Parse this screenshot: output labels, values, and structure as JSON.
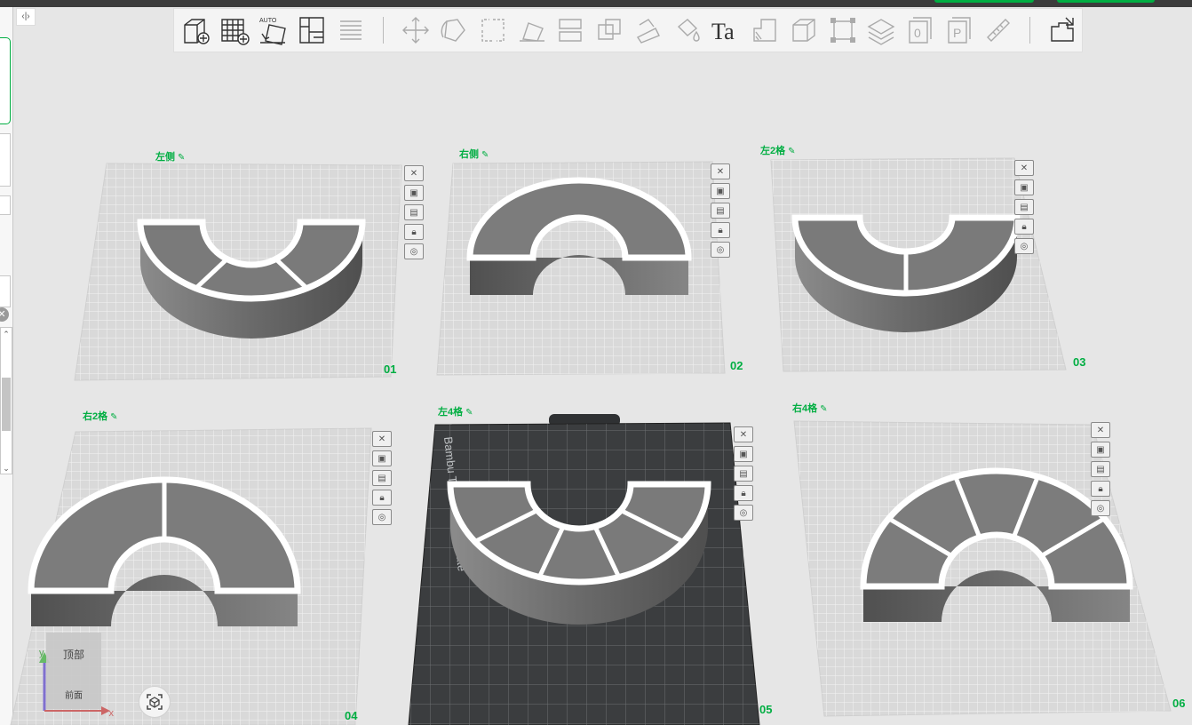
{
  "toolbar": {
    "collapse_glyph": "‹|›",
    "groups": [
      [
        "add-plate-icon",
        "grid-plate-icon",
        "auto-orient-icon",
        "arrange-icon",
        "layers-icon"
      ],
      [
        "move-icon",
        "rotate-icon",
        "scale-icon",
        "lay-on-face-icon",
        "split-icon",
        "boolean-icon",
        "support-paint-icon",
        "color-paint-icon",
        "text-icon",
        "height-range-icon",
        "cube-icon",
        "fit-bounds-icon",
        "layer-view-icon",
        "plate-0-icon",
        "plate-p-icon",
        "measure-icon"
      ],
      [
        "assembly-icon"
      ]
    ],
    "auto_label": "AUTO",
    "text_tool_label": "Ta"
  },
  "plates": [
    {
      "name": "左侧",
      "number": "01",
      "type": "blank"
    },
    {
      "name": "右侧",
      "number": "02",
      "type": "blank"
    },
    {
      "name": "左2格",
      "number": "03",
      "type": "blank"
    },
    {
      "name": "右2格",
      "number": "04",
      "type": "blank"
    },
    {
      "name": "左4格",
      "number": "05",
      "type": "textured",
      "plate_text": "Bambu Textured PEI Plate"
    },
    {
      "name": "右4格",
      "number": "06",
      "type": "blank"
    }
  ],
  "edit_glyph": "✎",
  "plate_buttons": [
    "close-plate-icon",
    "thumbnail-icon",
    "arrange-plate-icon",
    "lock-icon",
    "settings-icon"
  ],
  "navcube": {
    "top": "顶部",
    "front": "前面"
  },
  "axes": {
    "x": "x",
    "y": "y"
  },
  "colors": {
    "accent": "#00ae42",
    "background": "#e6e6e6",
    "plate": "#d9d9d9",
    "textured_plate": "#3b3d3f",
    "model": "#6f6f6f",
    "model_rim": "#ffffff"
  }
}
